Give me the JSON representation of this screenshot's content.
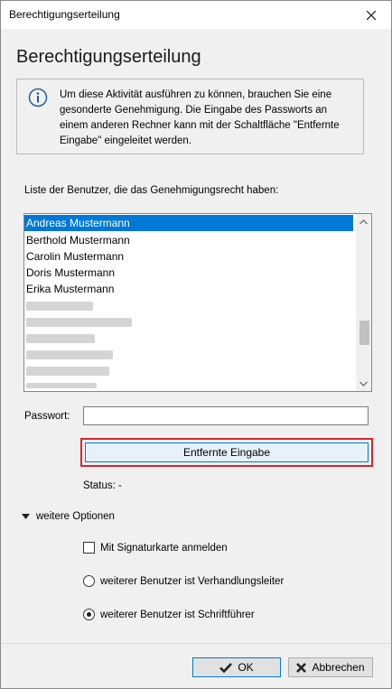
{
  "window": {
    "title": "Berechtigungserteilung"
  },
  "heading": "Berechtigungserteilung",
  "info": {
    "icon": "info-icon",
    "text": "Um diese Aktivität ausführen zu können, brauchen Sie eine gesonderte Genehmigung. Die Eingabe des Passworts an einem anderen Rechner kann mit der Schaltfläche \"Entfernte Eingabe\" eingeleitet werden."
  },
  "list": {
    "label": "Liste der Benutzer, die das Genehmigungsrecht haben:",
    "items": [
      {
        "label": "Andreas Mustermann",
        "selected": true
      },
      {
        "label": "Berthold Mustermann"
      },
      {
        "label": "Carolin Mustermann"
      },
      {
        "label": "Doris Mustermann"
      },
      {
        "label": "Erika Mustermann"
      }
    ],
    "obscured_count": 6
  },
  "password": {
    "label": "Passwort:",
    "value": ""
  },
  "remote_button": {
    "label": "Entfernte Eingabe"
  },
  "status": {
    "text": "Status: -"
  },
  "options": {
    "toggle_label": "weitere Optionen",
    "signature_card": {
      "label": "Mit Signaturkarte anmelden",
      "checked": false
    },
    "radio_chair": {
      "label": "weiterer Benutzer ist Verhandlungsleiter",
      "checked": false
    },
    "radio_clerk": {
      "label": "weiterer Benutzer ist Schriftführer",
      "checked": true
    }
  },
  "buttons": {
    "ok": "OK",
    "cancel": "Abbrechen"
  },
  "colors": {
    "selection": "#0078d7",
    "highlight_border": "#d9232d"
  }
}
